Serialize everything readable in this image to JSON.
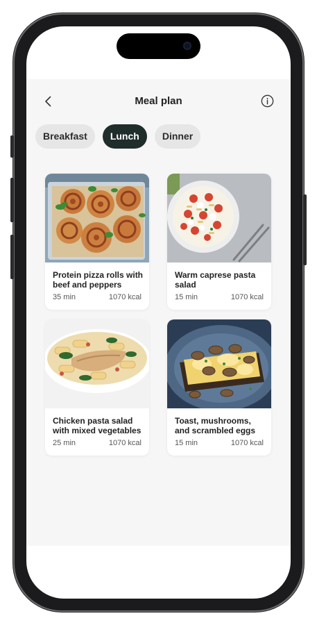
{
  "header": {
    "title": "Meal plan"
  },
  "tabs": [
    {
      "label": "Breakfast",
      "active": false
    },
    {
      "label": "Lunch",
      "active": true
    },
    {
      "label": "Dinner",
      "active": false
    }
  ],
  "meals": [
    {
      "name": "Protein pizza rolls with beef and peppers",
      "time": "35 min",
      "kcal": "1070 kcal"
    },
    {
      "name": "Warm caprese pasta salad",
      "time": "15 min",
      "kcal": "1070 kcal"
    },
    {
      "name": "Chicken pasta salad with mixed vegetables",
      "time": "25 min",
      "kcal": "1070 kcal"
    },
    {
      "name": "Toast, mushrooms, and scrambled eggs",
      "time": "15 min",
      "kcal": "1070 kcal"
    }
  ],
  "colors": {
    "active_tab": "#1f2d2b",
    "tab_bg": "#e6e6e6",
    "app_bg": "#f6f6f6"
  }
}
